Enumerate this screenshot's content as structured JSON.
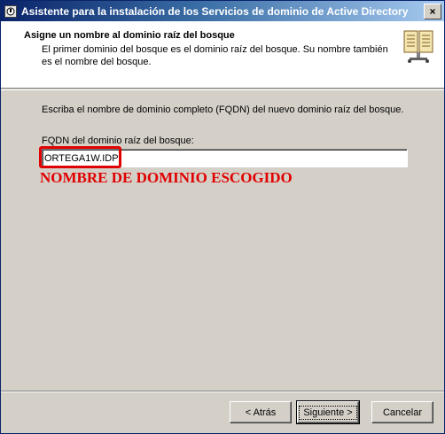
{
  "window": {
    "title": "Asistente para la instalación de los Servicios de dominio de Active Directory",
    "icon": "ad-wizard-icon",
    "close_label": "×"
  },
  "header": {
    "title": "Asigne un nombre al dominio raíz del bosque",
    "description": "El primer dominio del bosque es el dominio raíz del bosque. Su nombre también es el nombre del bosque.",
    "icon": "book-icon"
  },
  "body": {
    "instruction": "Escriba el nombre de dominio completo (FQDN) del nuevo dominio raíz del bosque.",
    "fqdn_label": "FQDN del dominio raíz del bosque:",
    "fqdn_value": "ORTEGA1W.IDP",
    "annotation": "NOMBRE DE DOMINIO ESCOGIDO",
    "annotation_color": "#e00000"
  },
  "buttons": {
    "back": "< Atrás",
    "next": "Siguiente >",
    "cancel": "Cancelar"
  },
  "colors": {
    "titlebar_start": "#0a246a",
    "titlebar_end": "#a6caf0",
    "dialog_bg": "#d4d0c8"
  }
}
